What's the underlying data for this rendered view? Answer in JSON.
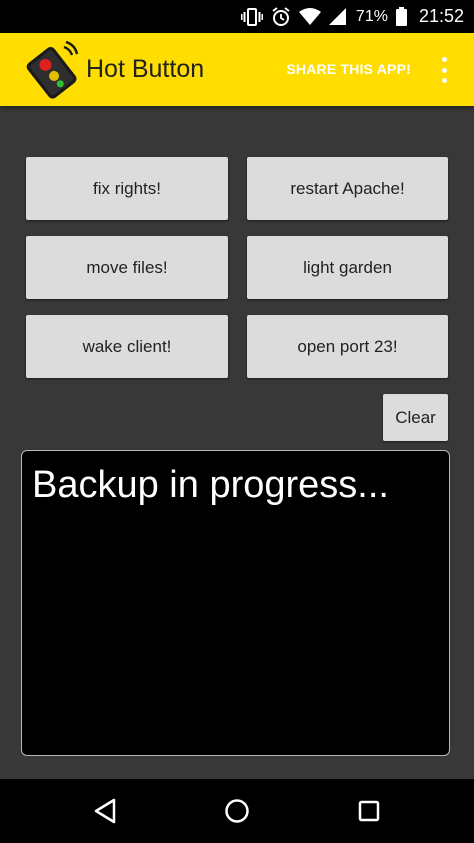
{
  "status_bar": {
    "battery_percent": "71%",
    "time": "21:52",
    "icons": [
      "vibrate-icon",
      "alarm-icon",
      "wifi-icon",
      "cell-signal-icon",
      "battery-icon"
    ]
  },
  "app_bar": {
    "title": "Hot Button",
    "share_label": "SHARE THIS APP!",
    "logo_icon": "remote-control-icon",
    "overflow_icon": "more-vert-icon"
  },
  "buttons": {
    "fix_rights": "fix rights!",
    "restart_apache": "restart Apache!",
    "move_files": "move files!",
    "light_garden": "light garden",
    "wake_client": "wake client!",
    "open_port_23": "open port 23!",
    "clear": "Clear"
  },
  "console": {
    "output": "Backup in progress..."
  },
  "nav_bar": {
    "icons": [
      "back-icon",
      "home-icon",
      "recents-icon"
    ]
  },
  "colors": {
    "app_bar": "#ffdd00",
    "background": "#383838",
    "button": "#dcdcdc",
    "console": "#000000"
  }
}
